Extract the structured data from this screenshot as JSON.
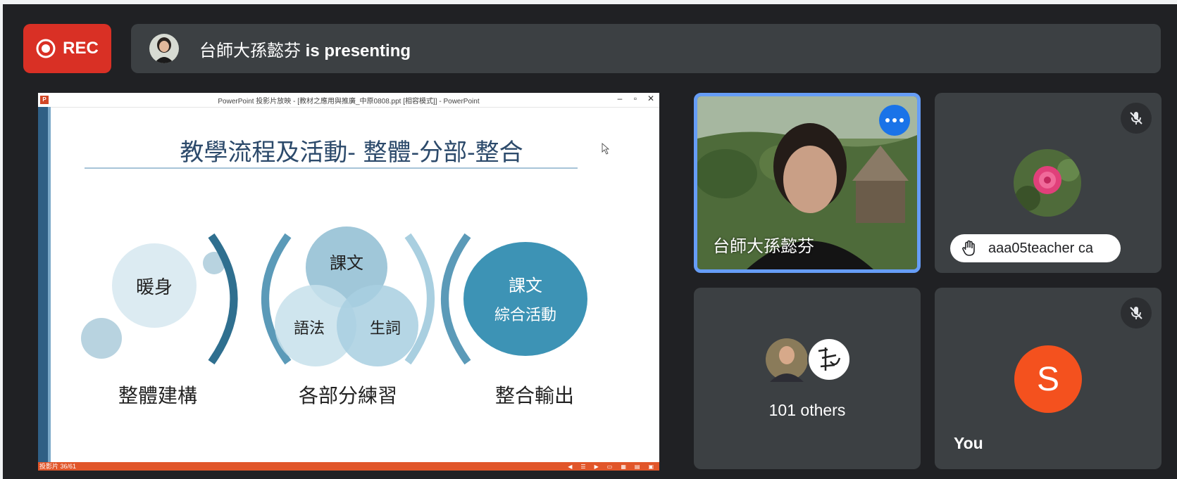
{
  "rec": {
    "label": "REC"
  },
  "banner": {
    "presenter_name": "台師大孫懿芬",
    "presenting_text": "is presenting"
  },
  "slide_window": {
    "window_title": "PowerPoint 投影片放映 - [教材之應用與推廣_中原0808.ppt [相容模式]] - PowerPoint",
    "logo": "P",
    "status_count": "投影片 36/61",
    "slide": {
      "title": "教學流程及活動- 整體-分部-整合",
      "warmup": "暖身",
      "text_top": "課文",
      "grammar": "語法",
      "vocab": "生詞",
      "combined_line1": "課文",
      "combined_line2": "綜合活動",
      "label_whole": "整體建構",
      "label_parts": "各部分練習",
      "label_output": "整合輸出"
    }
  },
  "tiles": {
    "main": {
      "name": "台師大孫懿芬"
    },
    "aaa": {
      "name": "aaa05teacher ca"
    },
    "others": {
      "label": "101 others"
    },
    "you": {
      "initial": "S",
      "label": "You"
    }
  },
  "colors": {
    "rec": "#d93025",
    "banner": "#3c4043",
    "tile": "#3c4043",
    "active_border": "#669df6",
    "more_button": "#1a73e8",
    "s_avatar": "#f4511e",
    "ppt_status": "#e1562a"
  }
}
